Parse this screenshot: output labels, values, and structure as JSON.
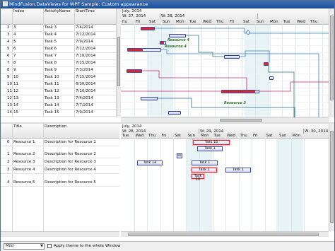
{
  "window": {
    "title": "MindFusion.DataViews for WPF Sample: Custom appearance"
  },
  "top_grid": {
    "columns": [
      "Index",
      "ActivityName",
      "StartTime"
    ],
    "rows": [
      {
        "row": "2",
        "index": "3",
        "activity": "Task 3",
        "start": "7/4/2014"
      },
      {
        "row": "3",
        "index": "4",
        "activity": "Task 4",
        "start": "7/12/2014"
      },
      {
        "row": "4",
        "index": "5",
        "activity": "Task 5",
        "start": "7/9/2014"
      },
      {
        "row": "5",
        "index": "6",
        "activity": "Task 6",
        "start": "7/12/2014"
      },
      {
        "row": "6",
        "index": "7",
        "activity": "Task 7",
        "start": "7/10/2014"
      },
      {
        "row": "7",
        "index": "8",
        "activity": "Task 8",
        "start": "7/15/2014"
      },
      {
        "row": "8",
        "index": "9",
        "activity": "Task 9",
        "start": "7/3/2014"
      },
      {
        "row": "9",
        "index": "10",
        "activity": "Task 10",
        "start": "7/15/2014"
      },
      {
        "row": "10",
        "index": "11",
        "activity": "Task 11",
        "start": "6/30/2014"
      },
      {
        "row": "11",
        "index": "12",
        "activity": "Task 12",
        "start": "7/10/2014"
      },
      {
        "row": "12",
        "index": "13",
        "activity": "Task 13",
        "start": "7/4/2014"
      },
      {
        "row": "13",
        "index": "14",
        "activity": "Task 14",
        "start": "7/7/2014"
      },
      {
        "row": "14",
        "index": "15",
        "activity": "Task 15",
        "start": "7/9/2014"
      }
    ]
  },
  "top_chart": {
    "month": "July, 2014",
    "week1": "W: 27, 2014",
    "week2": "W: 28, 2014",
    "days": [
      "hu",
      "Fri",
      "Sat",
      "Sun",
      "Mon",
      "Tue",
      "Wed",
      "Thu",
      "Fri",
      "Sat",
      "Sun",
      "Mon",
      "Tue",
      "Wed",
      "Thu"
    ],
    "labels": [
      "Resource 4",
      "Resource 4",
      "Resource 3"
    ]
  },
  "bottom_grid": {
    "columns": [
      "Title",
      "Description"
    ],
    "rows": [
      {
        "row": "0",
        "title": "Resource 1",
        "desc": "Description for Resource 1"
      },
      {
        "row": "1",
        "title": "Resource 2",
        "desc": "Description for Resource 2"
      },
      {
        "row": "2",
        "title": "Resource 3",
        "desc": "Description for Resource 3"
      },
      {
        "row": "3",
        "title": "Resource 4",
        "desc": "Description for Resource 4"
      },
      {
        "row": "4",
        "title": "Resource 5",
        "desc": "Description for Resource 5"
      }
    ]
  },
  "bottom_chart": {
    "month": "July, 2014",
    "week1": "W: 28, 2014",
    "week2": "W: 29, 2014",
    "week3": "W: 30, 2014",
    "days": [
      "Tue",
      "Wed",
      "Thu",
      "Fri",
      "Sat",
      "Sun",
      "Mon",
      "Tue",
      "Wed",
      "Thu",
      "Fri",
      "Sat",
      "Sun",
      "Mon"
    ],
    "tasks": [
      "Task 16",
      "Task 1",
      "sk",
      "Task 14",
      "Task 1",
      "Task 1",
      "Task 1",
      "Task 1",
      "Task 10"
    ]
  },
  "bottom_bar": {
    "theme_value": "Mild",
    "apply_label": "Apply theme to the whole Window"
  }
}
